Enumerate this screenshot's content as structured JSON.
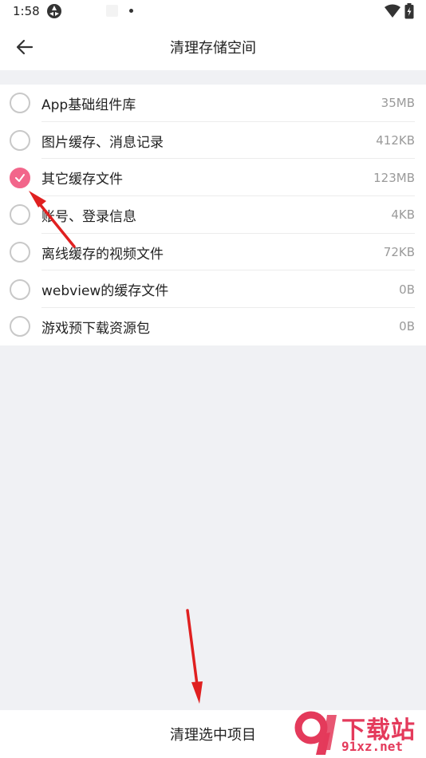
{
  "status_bar": {
    "time": "1:58"
  },
  "header": {
    "title": "清理存储空间"
  },
  "items": [
    {
      "label": "App基础组件库",
      "size": "35MB",
      "checked": false
    },
    {
      "label": "图片缓存、消息记录",
      "size": "412KB",
      "checked": false
    },
    {
      "label": "其它缓存文件",
      "size": "123MB",
      "checked": true
    },
    {
      "label": "账号、登录信息",
      "size": "4KB",
      "checked": false
    },
    {
      "label": "离线缓存的视频文件",
      "size": "72KB",
      "checked": false
    },
    {
      "label": "webview的缓存文件",
      "size": "0B",
      "checked": false
    },
    {
      "label": "游戏预下载资源包",
      "size": "0B",
      "checked": false
    }
  ],
  "footer": {
    "clean_button": "清理选中项目"
  },
  "watermark": {
    "title": "下载站",
    "url": "91xz.net"
  },
  "colors": {
    "accent": "#f2668b",
    "annotation_arrow": "#e02020"
  }
}
